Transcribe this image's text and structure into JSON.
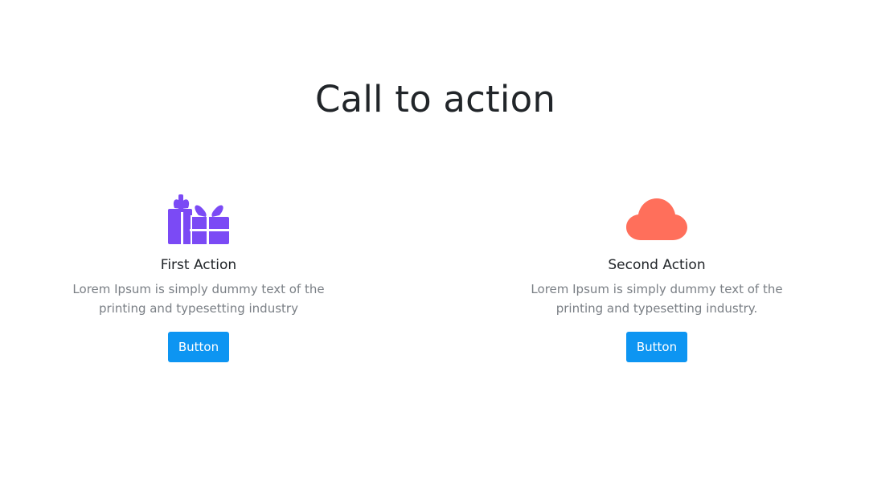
{
  "header": {
    "title": "Call to action"
  },
  "cards": [
    {
      "title": "First Action",
      "description": "Lorem Ipsum is simply dummy text of the printing and typesetting industry",
      "button_label": "Button",
      "icon": "gift-icon",
      "icon_color": "#7b4af5"
    },
    {
      "title": "Second Action",
      "description": "Lorem Ipsum is simply dummy text of the printing and typesetting industry.",
      "button_label": "Button",
      "icon": "cloud-icon",
      "icon_color": "#ff6f5b"
    }
  ],
  "colors": {
    "button_bg": "#0d95f2",
    "title_text": "#212529",
    "description_text": "#7a7f85"
  }
}
